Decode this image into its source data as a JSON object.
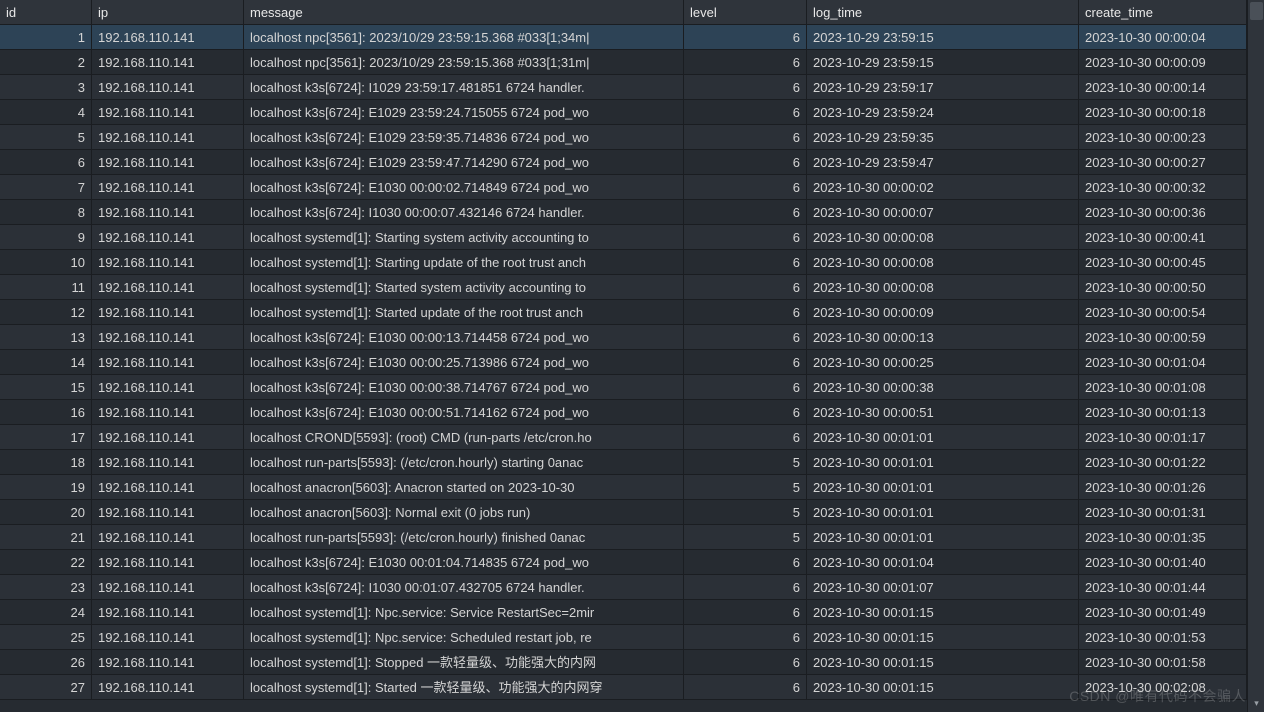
{
  "columns": {
    "id": "id",
    "ip": "ip",
    "message": "message",
    "level": "level",
    "log_time": "log_time",
    "create_time": "create_time"
  },
  "selected_row_index": 0,
  "watermark": "CSDN @唯有代码不会骗人",
  "rows": [
    {
      "id": "1",
      "ip": "192.168.110.141",
      "message": "localhost npc[3561]: 2023/10/29 23:59:15.368 #033[1;34m|",
      "level": "6",
      "log_time": "2023-10-29 23:59:15",
      "create_time": "2023-10-30 00:00:04"
    },
    {
      "id": "2",
      "ip": "192.168.110.141",
      "message": "localhost npc[3561]: 2023/10/29 23:59:15.368 #033[1;31m|",
      "level": "6",
      "log_time": "2023-10-29 23:59:15",
      "create_time": "2023-10-30 00:00:09"
    },
    {
      "id": "3",
      "ip": "192.168.110.141",
      "message": "localhost k3s[6724]: I1029 23:59:17.481851    6724 handler.",
      "level": "6",
      "log_time": "2023-10-29 23:59:17",
      "create_time": "2023-10-30 00:00:14"
    },
    {
      "id": "4",
      "ip": "192.168.110.141",
      "message": "localhost k3s[6724]: E1029 23:59:24.715055    6724 pod_wo",
      "level": "6",
      "log_time": "2023-10-29 23:59:24",
      "create_time": "2023-10-30 00:00:18"
    },
    {
      "id": "5",
      "ip": "192.168.110.141",
      "message": "localhost k3s[6724]: E1029 23:59:35.714836    6724 pod_wo",
      "level": "6",
      "log_time": "2023-10-29 23:59:35",
      "create_time": "2023-10-30 00:00:23"
    },
    {
      "id": "6",
      "ip": "192.168.110.141",
      "message": "localhost k3s[6724]: E1029 23:59:47.714290    6724 pod_wo",
      "level": "6",
      "log_time": "2023-10-29 23:59:47",
      "create_time": "2023-10-30 00:00:27"
    },
    {
      "id": "7",
      "ip": "192.168.110.141",
      "message": "localhost k3s[6724]: E1030 00:00:02.714849    6724 pod_wo",
      "level": "6",
      "log_time": "2023-10-30 00:00:02",
      "create_time": "2023-10-30 00:00:32"
    },
    {
      "id": "8",
      "ip": "192.168.110.141",
      "message": "localhost k3s[6724]: I1030 00:00:07.432146    6724 handler.",
      "level": "6",
      "log_time": "2023-10-30 00:00:07",
      "create_time": "2023-10-30 00:00:36"
    },
    {
      "id": "9",
      "ip": "192.168.110.141",
      "message": "localhost systemd[1]: Starting system activity accounting to",
      "level": "6",
      "log_time": "2023-10-30 00:00:08",
      "create_time": "2023-10-30 00:00:41"
    },
    {
      "id": "10",
      "ip": "192.168.110.141",
      "message": "localhost systemd[1]: Starting update of the root trust anch",
      "level": "6",
      "log_time": "2023-10-30 00:00:08",
      "create_time": "2023-10-30 00:00:45"
    },
    {
      "id": "11",
      "ip": "192.168.110.141",
      "message": "localhost systemd[1]: Started system activity accounting to",
      "level": "6",
      "log_time": "2023-10-30 00:00:08",
      "create_time": "2023-10-30 00:00:50"
    },
    {
      "id": "12",
      "ip": "192.168.110.141",
      "message": "localhost systemd[1]: Started update of the root trust anch",
      "level": "6",
      "log_time": "2023-10-30 00:00:09",
      "create_time": "2023-10-30 00:00:54"
    },
    {
      "id": "13",
      "ip": "192.168.110.141",
      "message": "localhost k3s[6724]: E1030 00:00:13.714458    6724 pod_wo",
      "level": "6",
      "log_time": "2023-10-30 00:00:13",
      "create_time": "2023-10-30 00:00:59"
    },
    {
      "id": "14",
      "ip": "192.168.110.141",
      "message": "localhost k3s[6724]: E1030 00:00:25.713986    6724 pod_wo",
      "level": "6",
      "log_time": "2023-10-30 00:00:25",
      "create_time": "2023-10-30 00:01:04"
    },
    {
      "id": "15",
      "ip": "192.168.110.141",
      "message": "localhost k3s[6724]: E1030 00:00:38.714767    6724 pod_wo",
      "level": "6",
      "log_time": "2023-10-30 00:00:38",
      "create_time": "2023-10-30 00:01:08"
    },
    {
      "id": "16",
      "ip": "192.168.110.141",
      "message": "localhost k3s[6724]: E1030 00:00:51.714162    6724 pod_wo",
      "level": "6",
      "log_time": "2023-10-30 00:00:51",
      "create_time": "2023-10-30 00:01:13"
    },
    {
      "id": "17",
      "ip": "192.168.110.141",
      "message": "localhost CROND[5593]: (root) CMD (run-parts /etc/cron.ho",
      "level": "6",
      "log_time": "2023-10-30 00:01:01",
      "create_time": "2023-10-30 00:01:17"
    },
    {
      "id": "18",
      "ip": "192.168.110.141",
      "message": "localhost run-parts[5593]: (/etc/cron.hourly) starting 0anac",
      "level": "5",
      "log_time": "2023-10-30 00:01:01",
      "create_time": "2023-10-30 00:01:22"
    },
    {
      "id": "19",
      "ip": "192.168.110.141",
      "message": "localhost anacron[5603]: Anacron started on 2023-10-30",
      "level": "5",
      "log_time": "2023-10-30 00:01:01",
      "create_time": "2023-10-30 00:01:26"
    },
    {
      "id": "20",
      "ip": "192.168.110.141",
      "message": "localhost anacron[5603]: Normal exit (0 jobs run)",
      "level": "5",
      "log_time": "2023-10-30 00:01:01",
      "create_time": "2023-10-30 00:01:31"
    },
    {
      "id": "21",
      "ip": "192.168.110.141",
      "message": "localhost run-parts[5593]: (/etc/cron.hourly) finished 0anac",
      "level": "5",
      "log_time": "2023-10-30 00:01:01",
      "create_time": "2023-10-30 00:01:35"
    },
    {
      "id": "22",
      "ip": "192.168.110.141",
      "message": "localhost k3s[6724]: E1030 00:01:04.714835    6724 pod_wo",
      "level": "6",
      "log_time": "2023-10-30 00:01:04",
      "create_time": "2023-10-30 00:01:40"
    },
    {
      "id": "23",
      "ip": "192.168.110.141",
      "message": "localhost k3s[6724]: I1030 00:01:07.432705    6724 handler.",
      "level": "6",
      "log_time": "2023-10-30 00:01:07",
      "create_time": "2023-10-30 00:01:44"
    },
    {
      "id": "24",
      "ip": "192.168.110.141",
      "message": "localhost systemd[1]: Npc.service: Service RestartSec=2mir",
      "level": "6",
      "log_time": "2023-10-30 00:01:15",
      "create_time": "2023-10-30 00:01:49"
    },
    {
      "id": "25",
      "ip": "192.168.110.141",
      "message": "localhost systemd[1]: Npc.service: Scheduled restart job, re",
      "level": "6",
      "log_time": "2023-10-30 00:01:15",
      "create_time": "2023-10-30 00:01:53"
    },
    {
      "id": "26",
      "ip": "192.168.110.141",
      "message": "localhost systemd[1]: Stopped 一款轻量级、功能强大的内网",
      "level": "6",
      "log_time": "2023-10-30 00:01:15",
      "create_time": "2023-10-30 00:01:58"
    },
    {
      "id": "27",
      "ip": "192.168.110.141",
      "message": "localhost systemd[1]: Started 一款轻量级、功能强大的内网穿",
      "level": "6",
      "log_time": "2023-10-30 00:01:15",
      "create_time": "2023-10-30 00:02:08"
    }
  ]
}
